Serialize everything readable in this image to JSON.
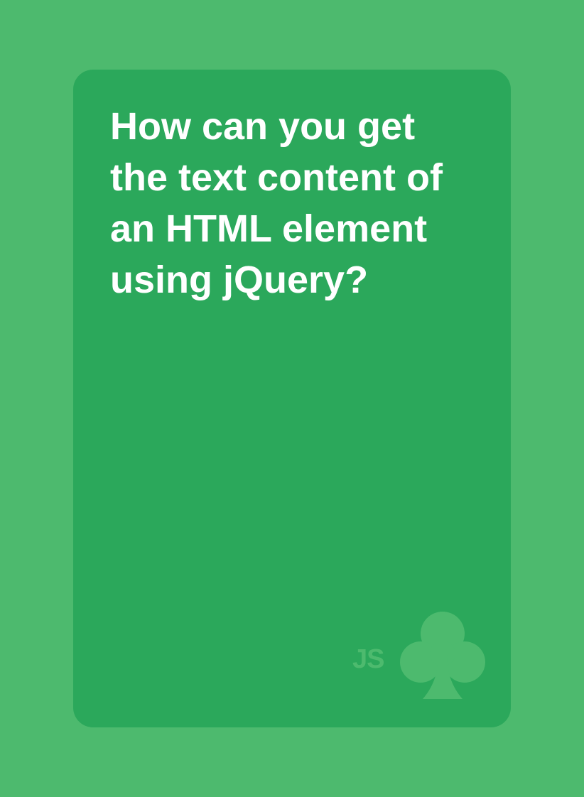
{
  "colors": {
    "background": "#4dba6e",
    "card": "#2ba85b",
    "text": "#ffffff",
    "mark": "#4dba6e"
  },
  "card": {
    "question_lines": [
      "How can you get",
      "the text content of",
      "an HTML element",
      "using jQuery?"
    ],
    "brand": {
      "label": "JS",
      "icon": "club-icon"
    }
  }
}
